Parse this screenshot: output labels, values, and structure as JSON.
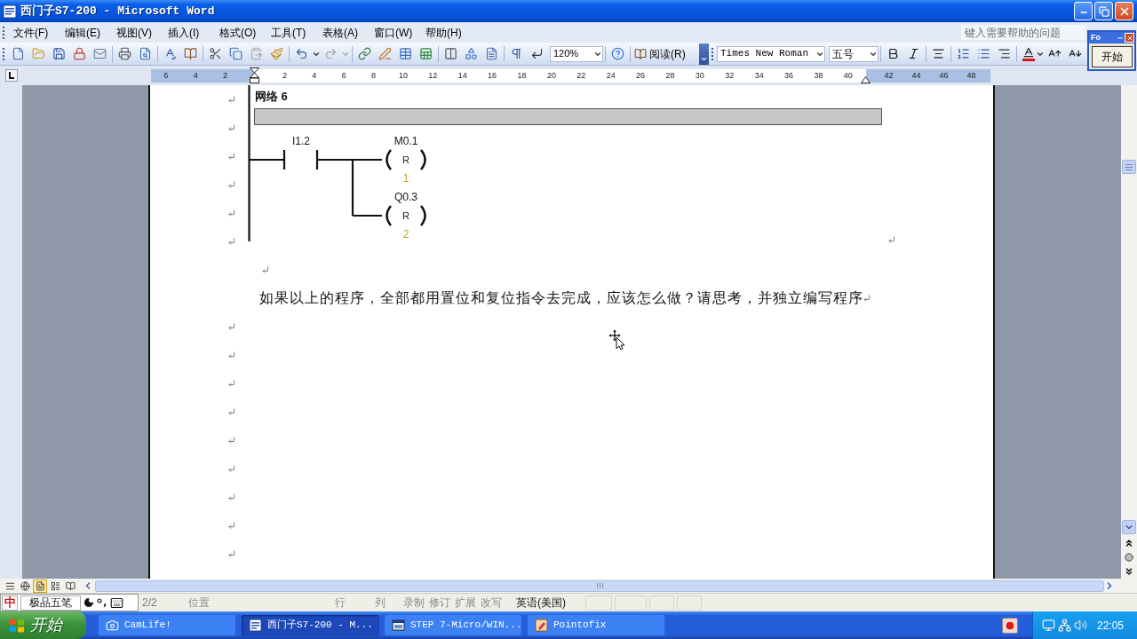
{
  "window": {
    "title": "西门子S7-200 - Microsoft Word"
  },
  "menu_bar": {
    "items": [
      "文件(F)",
      "编辑(E)",
      "视图(V)",
      "插入(I)",
      "格式(O)",
      "工具(T)",
      "表格(A)",
      "窗口(W)",
      "帮助(H)"
    ],
    "help_box": {
      "placeholder": "键入需要帮助的问题"
    }
  },
  "toolbar": {
    "zoom": "120%",
    "read_button": "阅读(R)",
    "font": "Times New Roman",
    "font_size": "五号"
  },
  "floating_window": {
    "title": "Fo",
    "button": "开始"
  },
  "ruler": {
    "left_numbers": [
      "6",
      "4",
      "2"
    ],
    "numbers": [
      "2",
      "4",
      "6",
      "8",
      "10",
      "12",
      "14",
      "16",
      "18",
      "20",
      "22",
      "24",
      "26",
      "28",
      "30",
      "32",
      "34",
      "36",
      "38",
      "40"
    ],
    "right_numbers": [
      "42",
      "44",
      "46",
      "48"
    ]
  },
  "document": {
    "network": {
      "title": "网络 6",
      "contact": "I1.2",
      "coils": [
        {
          "address": "M0.1",
          "type": "R",
          "count": "1"
        },
        {
          "address": "Q0.3",
          "type": "R",
          "count": "2"
        }
      ]
    },
    "paragraph": "如果以上的程序，全部都用置位和复位指令去完成，应该怎么做？请思考，并独立编写程序"
  },
  "view_buttons": [
    {
      "kind": "normal",
      "selected": false
    },
    {
      "kind": "web",
      "selected": false
    },
    {
      "kind": "print",
      "selected": true
    },
    {
      "kind": "outline",
      "selected": false
    },
    {
      "kind": "reading",
      "selected": false
    }
  ],
  "status_bar": {
    "ime": {
      "mode": "中",
      "name": "极品五笔"
    },
    "page": "2/2",
    "fields": [
      {
        "label": "位置",
        "disabled": true
      },
      {
        "label": "行",
        "disabled": true
      },
      {
        "label": "列",
        "disabled": true
      },
      {
        "label": "录制",
        "disabled": true
      },
      {
        "label": "修订",
        "disabled": true
      },
      {
        "label": "扩展",
        "disabled": true
      },
      {
        "label": "改写",
        "disabled": true
      }
    ],
    "language": {
      "label": "英语(美国)",
      "disabled": false
    }
  },
  "taskbar": {
    "start": "开始",
    "items": [
      {
        "kind": "camera",
        "label": "CamLife!",
        "selected": false
      },
      {
        "kind": "word",
        "label": "西门子S7-200 - M...",
        "selected": true
      },
      {
        "kind": "step7",
        "label": "STEP 7-Micro/WIN...",
        "selected": false
      },
      {
        "kind": "pen",
        "label": "Pointofix",
        "selected": false
      }
    ],
    "clock": "22:05"
  }
}
